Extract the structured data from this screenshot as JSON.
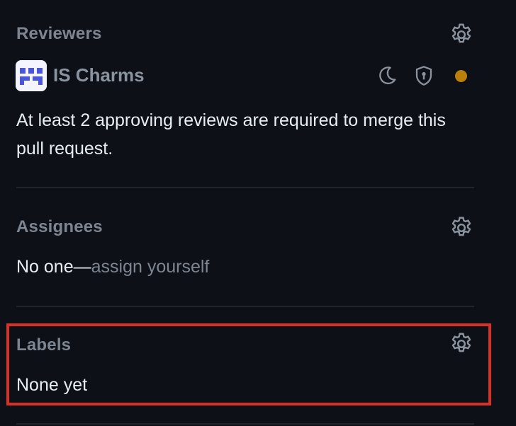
{
  "reviewers": {
    "title": "Reviewers",
    "reviewer": {
      "name": "IS Charms",
      "status_icons": [
        "moon-icon",
        "shield-lock-icon",
        "pending-dot-icon"
      ],
      "pending_color": "#bb8009"
    },
    "requirement_text": "At least 2 approving reviews are required to merge this pull request."
  },
  "assignees": {
    "title": "Assignees",
    "none_text": "No one—",
    "assign_link": "assign yourself"
  },
  "labels": {
    "title": "Labels",
    "value": "None yet"
  },
  "colors": {
    "background": "#0d1117",
    "muted": "#7d8590",
    "text": "#e6edf3",
    "highlight": "#d93025"
  }
}
